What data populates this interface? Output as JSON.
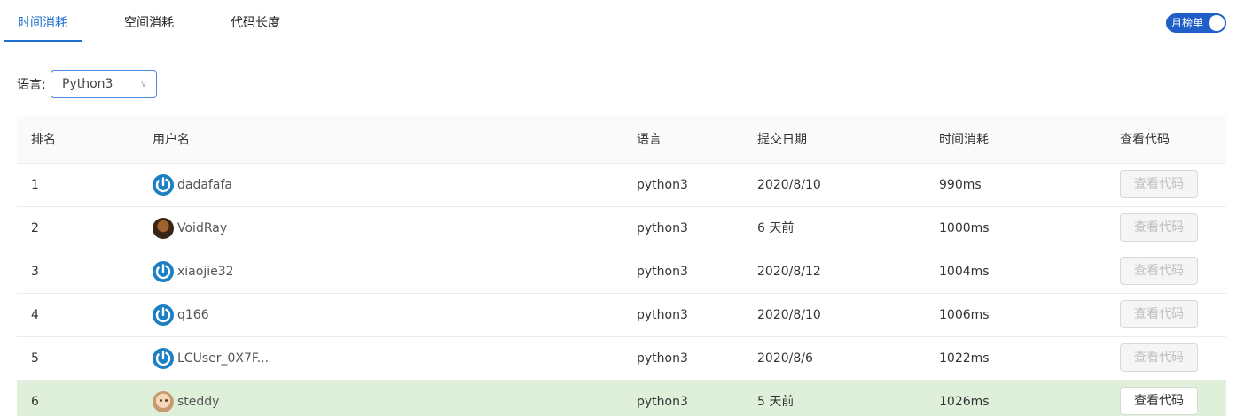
{
  "tabs": [
    {
      "label": "时间消耗"
    },
    {
      "label": "空间消耗"
    },
    {
      "label": "代码长度"
    }
  ],
  "toggle": {
    "label": "月榜单",
    "on": true
  },
  "filter": {
    "label": "语言:",
    "selected": "Python3"
  },
  "table": {
    "headers": [
      "排名",
      "用户名",
      "语言",
      "提交日期",
      "时间消耗",
      "查看代码"
    ],
    "rows": [
      {
        "rank": "1",
        "user": "dadafafa",
        "avatar": "power-icon",
        "lang": "python3",
        "date": "2020/8/10",
        "time": "990ms",
        "button": "查看代码",
        "enabled": false
      },
      {
        "rank": "2",
        "user": "VoidRay",
        "avatar": "photo-avatar",
        "lang": "python3",
        "date": "6 天前",
        "time": "1000ms",
        "button": "查看代码",
        "enabled": false
      },
      {
        "rank": "3",
        "user": "xiaojie32",
        "avatar": "power-icon",
        "lang": "python3",
        "date": "2020/8/12",
        "time": "1004ms",
        "button": "查看代码",
        "enabled": false
      },
      {
        "rank": "4",
        "user": "q166",
        "avatar": "power-icon",
        "lang": "python3",
        "date": "2020/8/10",
        "time": "1006ms",
        "button": "查看代码",
        "enabled": false
      },
      {
        "rank": "5",
        "user": "LCUser_0X7F...",
        "avatar": "power-icon",
        "lang": "python3",
        "date": "2020/8/6",
        "time": "1022ms",
        "button": "查看代码",
        "enabled": false
      },
      {
        "rank": "6",
        "user": "steddy",
        "avatar": "photo-avatar",
        "lang": "python3",
        "date": "5 天前",
        "time": "1026ms",
        "button": "查看代码",
        "enabled": true,
        "highlighted": true
      }
    ]
  },
  "colors": {
    "accent": "#1f6fd1",
    "highlight_row": "#dff0da"
  }
}
